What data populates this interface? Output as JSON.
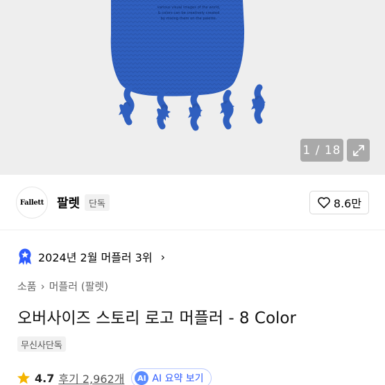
{
  "gallery": {
    "counter": "1 / 18",
    "product_text_lines": [
      "various visual images of the world,",
      "& colors can be creatively created",
      "by mixing them on the palette."
    ]
  },
  "brand": {
    "logo_text": "Fallett",
    "name": "팔렛",
    "badge": "단독",
    "likes": "8.6만"
  },
  "ranking": {
    "text": "2024년 2월 머플러 3위",
    "chevron": "›"
  },
  "breadcrumb": {
    "level1": "소품",
    "separator": "›",
    "level2": "머플러 (팔렛)"
  },
  "product": {
    "title": "오버사이즈 스토리 로고 머플러 - 8 Color",
    "exclusive_badge": "무신사단독"
  },
  "rating": {
    "value": "4.7",
    "reviews": "후기 2,962개",
    "ai_icon": "AI",
    "ai_label": "AI 요약 보기"
  },
  "colors": {
    "scarf_blue": "#2f5fbf",
    "hero_bg": "#eeeeee",
    "star": "#f5b400",
    "ai_blue": "#2d5bff"
  },
  "icons": [
    "expand-icon",
    "heart-icon",
    "ranking-medal-icon",
    "star-icon",
    "chevron-right-icon"
  ]
}
